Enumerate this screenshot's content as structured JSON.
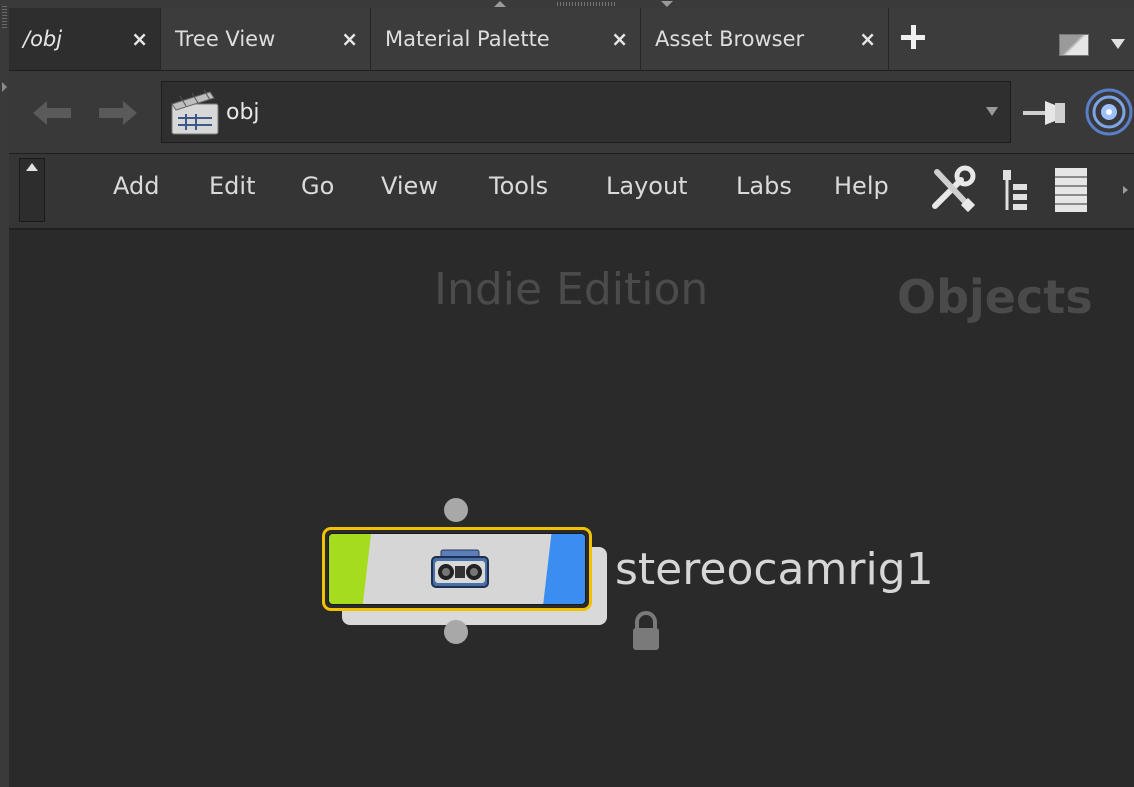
{
  "tabs": [
    {
      "label": "/obj",
      "active": true
    },
    {
      "label": "Tree View",
      "active": false
    },
    {
      "label": "Material Palette",
      "active": false
    },
    {
      "label": "Asset Browser",
      "active": false
    }
  ],
  "tab_close_glyph": "×",
  "path": {
    "value": "obj"
  },
  "menu": [
    "Add",
    "Edit",
    "Go",
    "View",
    "Tools",
    "Layout",
    "Labs",
    "Help"
  ],
  "canvas": {
    "edition_watermark": "Indie Edition",
    "context_watermark": "Objects"
  },
  "node": {
    "name": "stereocamrig1",
    "icon": "stereo-camera-icon",
    "locked": true,
    "colors": {
      "display_flag": "#a6dc1e",
      "render_flag": "#3a8ef2",
      "selection_outline": "#f2c200"
    }
  },
  "icons": {
    "back": "back-arrow-icon",
    "forward": "forward-arrow-icon",
    "path": "obj-network-icon",
    "pin": "pin-icon",
    "link": "link-target-icon",
    "tools": "tools-icon",
    "tree": "tree-icon",
    "list": "list-icon"
  }
}
